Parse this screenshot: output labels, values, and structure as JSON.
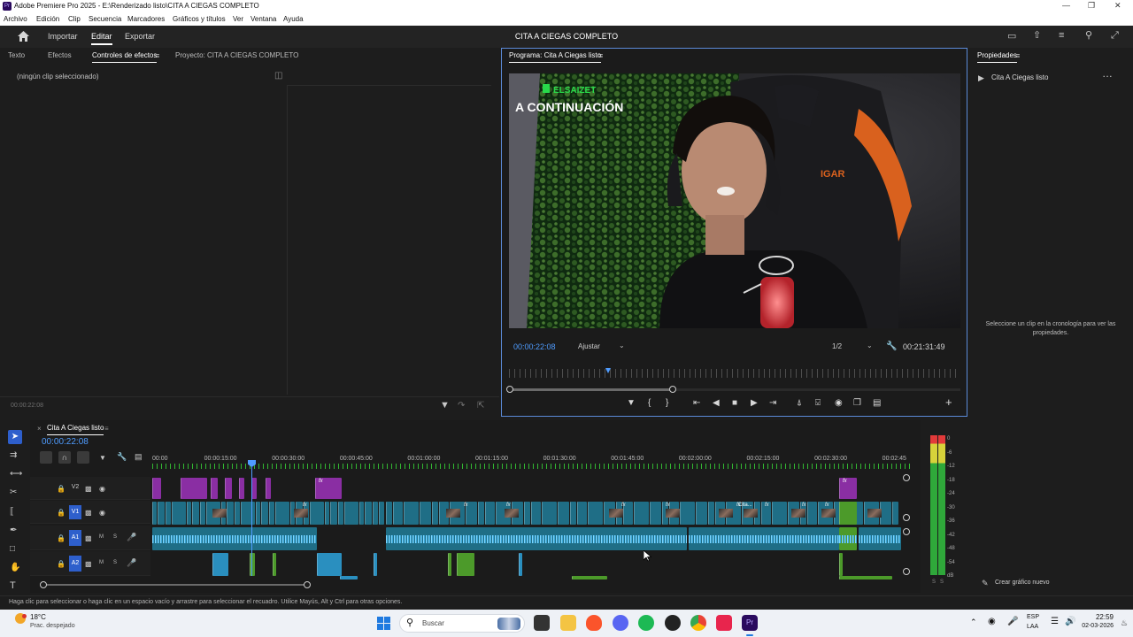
{
  "window": {
    "title": "Adobe Premiere Pro 2025 - E:\\Renderizado listo\\CITA A CIEGAS COMPLETO",
    "logo_text": "Pr"
  },
  "menu": [
    "Archivo",
    "Edición",
    "Clip",
    "Secuencia",
    "Marcadores",
    "Gráficos y títulos",
    "Ver",
    "Ventana",
    "Ayuda"
  ],
  "appbar": {
    "nav": [
      "Importar",
      "Editar",
      "Exportar"
    ],
    "active": "Editar",
    "project_title": "CITA A CIEGAS COMPLETO"
  },
  "left_panel": {
    "tabs": [
      "Texto",
      "Efectos",
      "Controles de efectos",
      "Proyecto: CITA A CIEGAS COMPLETO"
    ],
    "active_tab": "Controles de efectos",
    "no_clip": "(ningún clip seleccionado)",
    "timecode": "00:00:22:08"
  },
  "program": {
    "tab": "Programa: Cita A Ciegas listo",
    "overlay_brand": "ELSAIZET",
    "overlay_title": "A CONTINUACIÓN",
    "chair_text": "IGAR",
    "timecode": "00:00:22:08",
    "fit": "Ajustar",
    "resolution": "1/2",
    "duration": "00:21:31:49"
  },
  "properties": {
    "tab": "Propiedades",
    "item": "Cita A Ciegas listo",
    "hint": "Seleccione un clip en la cronología para ver las propiedades.",
    "new_graphic": "Crear gráfico nuevo"
  },
  "timeline": {
    "sequence": "Cita A Ciegas listo",
    "timecode": "00:00:22:08",
    "ruler": [
      "00:00",
      "00:00:15:00",
      "00:00:30:00",
      "00:00:45:00",
      "00:01:00:00",
      "00:01:15:00",
      "00:01:30:00",
      "00:01:45:00",
      "00:02:00:00",
      "00:02:15:00",
      "00:02:30:00",
      "00:02:45"
    ],
    "tracks": [
      {
        "name": "V2",
        "mute": "",
        "solo": ""
      },
      {
        "name": "V1",
        "mute": "",
        "solo": ""
      },
      {
        "name": "A1",
        "mute": "M",
        "solo": "S"
      },
      {
        "name": "A2",
        "mute": "M",
        "solo": "S"
      }
    ],
    "fx_label": "fx",
    "clip_label": "Cita..."
  },
  "meter": {
    "scale": [
      "0",
      "-6",
      "-12",
      "-18",
      "-24",
      "-30",
      "-36",
      "-42",
      "-48",
      "-54",
      "dB"
    ],
    "bottom": [
      "S",
      "S"
    ]
  },
  "status_text": "Haga clic para seleccionar o haga clic en un espacio vacío y arrastre para seleccionar el recuadro. Utilice Mayús, Alt y Ctrl para otras opciones.",
  "taskbar": {
    "weather_temp": "18°C",
    "weather_desc": "Prac. despejado",
    "search": "Buscar",
    "lang_top": "ESP",
    "lang_bottom": "LAA",
    "time": "22:59",
    "date": "02-03-2026"
  },
  "colors": {
    "accent": "#5b8ad8",
    "video_clip": "#1f6e86",
    "audio_clip": "#2a8fbf",
    "purple_clip": "#8a2ea3",
    "green_clip": "#4c9a2a",
    "playhead": "#4f9cff"
  }
}
